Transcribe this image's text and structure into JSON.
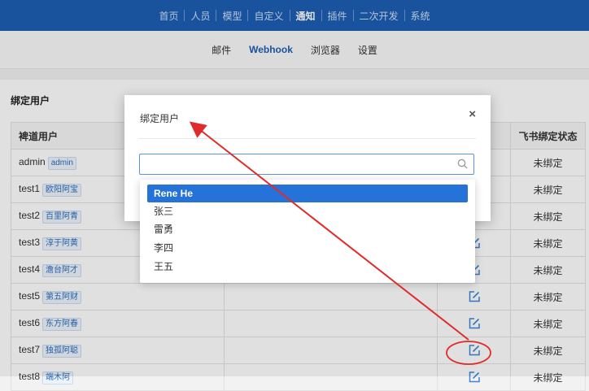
{
  "topnav": {
    "items": [
      {
        "label": "首页"
      },
      {
        "label": "人员"
      },
      {
        "label": "模型"
      },
      {
        "label": "自定义"
      },
      {
        "label": "通知"
      },
      {
        "label": "插件"
      },
      {
        "label": "二次开发"
      },
      {
        "label": "系统"
      }
    ],
    "active_index": 4
  },
  "subnav": {
    "items": [
      {
        "label": "邮件"
      },
      {
        "label": "Webhook"
      },
      {
        "label": "浏览器"
      },
      {
        "label": "设置"
      }
    ],
    "active_index": 1
  },
  "panel": {
    "title": "绑定用户",
    "columns": {
      "user": "裨道用户",
      "status": "飞书绑定状态"
    },
    "rows": [
      {
        "user": "admin",
        "nickname": "admin",
        "status": "未绑定",
        "edit": false
      },
      {
        "user": "test1",
        "nickname": "欧阳阿宝",
        "status": "未绑定",
        "edit": false
      },
      {
        "user": "test2",
        "nickname": "百里阿青",
        "status": "未绑定",
        "edit": false
      },
      {
        "user": "test3",
        "nickname": "淳于阿黄",
        "status": "未绑定",
        "edit": true
      },
      {
        "user": "test4",
        "nickname": "澹台阿才",
        "status": "未绑定",
        "edit": true
      },
      {
        "user": "test5",
        "nickname": "第五阿财",
        "status": "未绑定",
        "edit": true
      },
      {
        "user": "test6",
        "nickname": "东方阿春",
        "status": "未绑定",
        "edit": true
      },
      {
        "user": "test7",
        "nickname": "独孤阿聪",
        "status": "未绑定",
        "edit": true
      },
      {
        "user": "test8",
        "nickname": "端木阿",
        "status": "未绑定",
        "edit": true
      }
    ]
  },
  "modal": {
    "title": "绑定用户",
    "close_label": "×",
    "search": {
      "value": "",
      "placeholder": ""
    },
    "options": [
      {
        "label": "Rene He",
        "selected": true
      },
      {
        "label": "张三",
        "selected": false
      },
      {
        "label": "雷勇",
        "selected": false
      },
      {
        "label": "李四",
        "selected": false
      },
      {
        "label": "王五",
        "selected": false
      }
    ]
  },
  "colors": {
    "nav_bg": "#1d5fb3",
    "accent": "#2573d9",
    "annotation": "#e02b2b"
  },
  "icons": {
    "edit": "edit-icon",
    "search": "search-icon",
    "close": "close-icon"
  }
}
